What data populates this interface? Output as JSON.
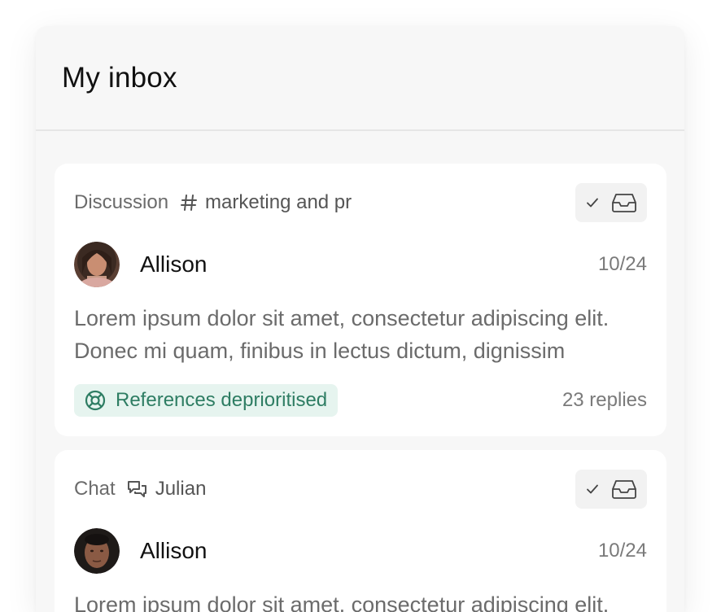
{
  "inbox": {
    "title": "My inbox",
    "items": [
      {
        "context_type": "Discussion",
        "context_icon": "hash-icon",
        "context_name": "marketing and pr",
        "author": "Allison",
        "date": "10/24",
        "body": "Lorem ipsum dolor sit amet, consectetur adipiscing elit. Donec mi quam, finibus in lectus dictum, dignissim",
        "tag": "References deprioritised",
        "replies": "23 replies"
      },
      {
        "context_type": "Chat",
        "context_icon": "chat-bubbles-icon",
        "context_name": "Julian",
        "author": "Allison",
        "date": "10/24",
        "body": "Lorem ipsum dolor sit amet, consectetur adipiscing elit."
      }
    ]
  },
  "colors": {
    "panel_bg": "#f7f7f7",
    "card_bg": "#ffffff",
    "tag_bg": "#e6f4ef",
    "tag_text": "#2e7d63"
  }
}
